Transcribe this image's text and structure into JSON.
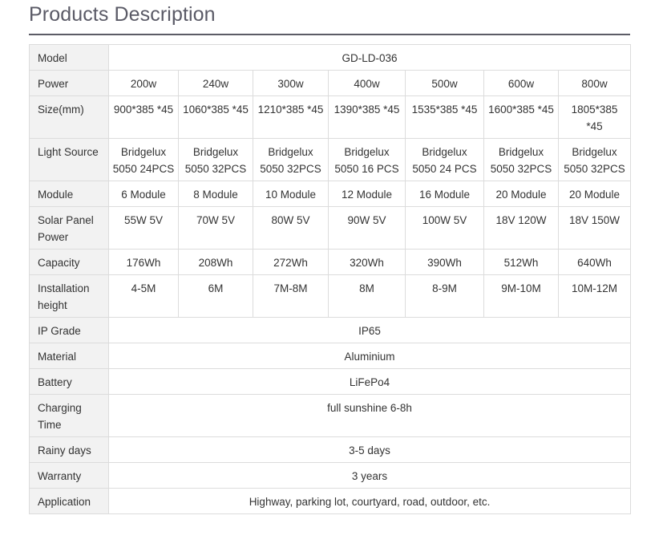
{
  "page": {
    "title": "Products Description"
  },
  "table": {
    "rows": [
      {
        "label": "Model",
        "span": "GD-LD-036"
      },
      {
        "label": "Power",
        "cells": [
          "200w",
          "240w",
          "300w",
          "400w",
          "500w",
          "600w",
          "800w"
        ]
      },
      {
        "label": "Size(mm)",
        "cells": [
          "900*385 *45",
          "1060*385 *45",
          "1210*385 *45",
          "1390*385 *45",
          "1535*385 *45",
          "1600*385 *45",
          "1805*385 *45"
        ]
      },
      {
        "label": "Light Source",
        "cells": [
          "Bridgelux 5050 24PCS",
          "Bridgelux 5050 32PCS",
          "Bridgelux 5050 32PCS",
          "Bridgelux 5050 16 PCS",
          "Bridgelux 5050 24 PCS",
          "Bridgelux 5050 32PCS",
          "Bridgelux 5050 32PCS"
        ]
      },
      {
        "label": "Module",
        "cells": [
          "6 Module",
          "8 Module",
          "10 Module",
          "12 Module",
          "16 Module",
          "20 Module",
          "20 Module"
        ]
      },
      {
        "label": "Solar Panel Power",
        "cells": [
          "55W 5V",
          "70W 5V",
          "80W 5V",
          "90W 5V",
          "100W 5V",
          "18V 120W",
          "18V 150W"
        ]
      },
      {
        "label": "Capacity",
        "cells": [
          "176Wh",
          "208Wh",
          "272Wh",
          "320Wh",
          "390Wh",
          "512Wh",
          "640Wh"
        ]
      },
      {
        "label": "Installation height",
        "cells": [
          "4-5M",
          "6M",
          "7M-8M",
          "8M",
          "8-9M",
          "9M-10M",
          "10M-12M"
        ]
      },
      {
        "label": "IP Grade",
        "span": "IP65"
      },
      {
        "label": "Material",
        "span": "Aluminium"
      },
      {
        "label": "Battery",
        "span": "LiFePo4"
      },
      {
        "label": "Charging Time",
        "span": "full sunshine 6-8h"
      },
      {
        "label": "Rainy days",
        "span": "3-5 days"
      },
      {
        "label": "Warranty",
        "span": "3 years"
      },
      {
        "label": "Application",
        "span": "Highway, parking lot, courtyard, road, outdoor, etc."
      }
    ]
  }
}
